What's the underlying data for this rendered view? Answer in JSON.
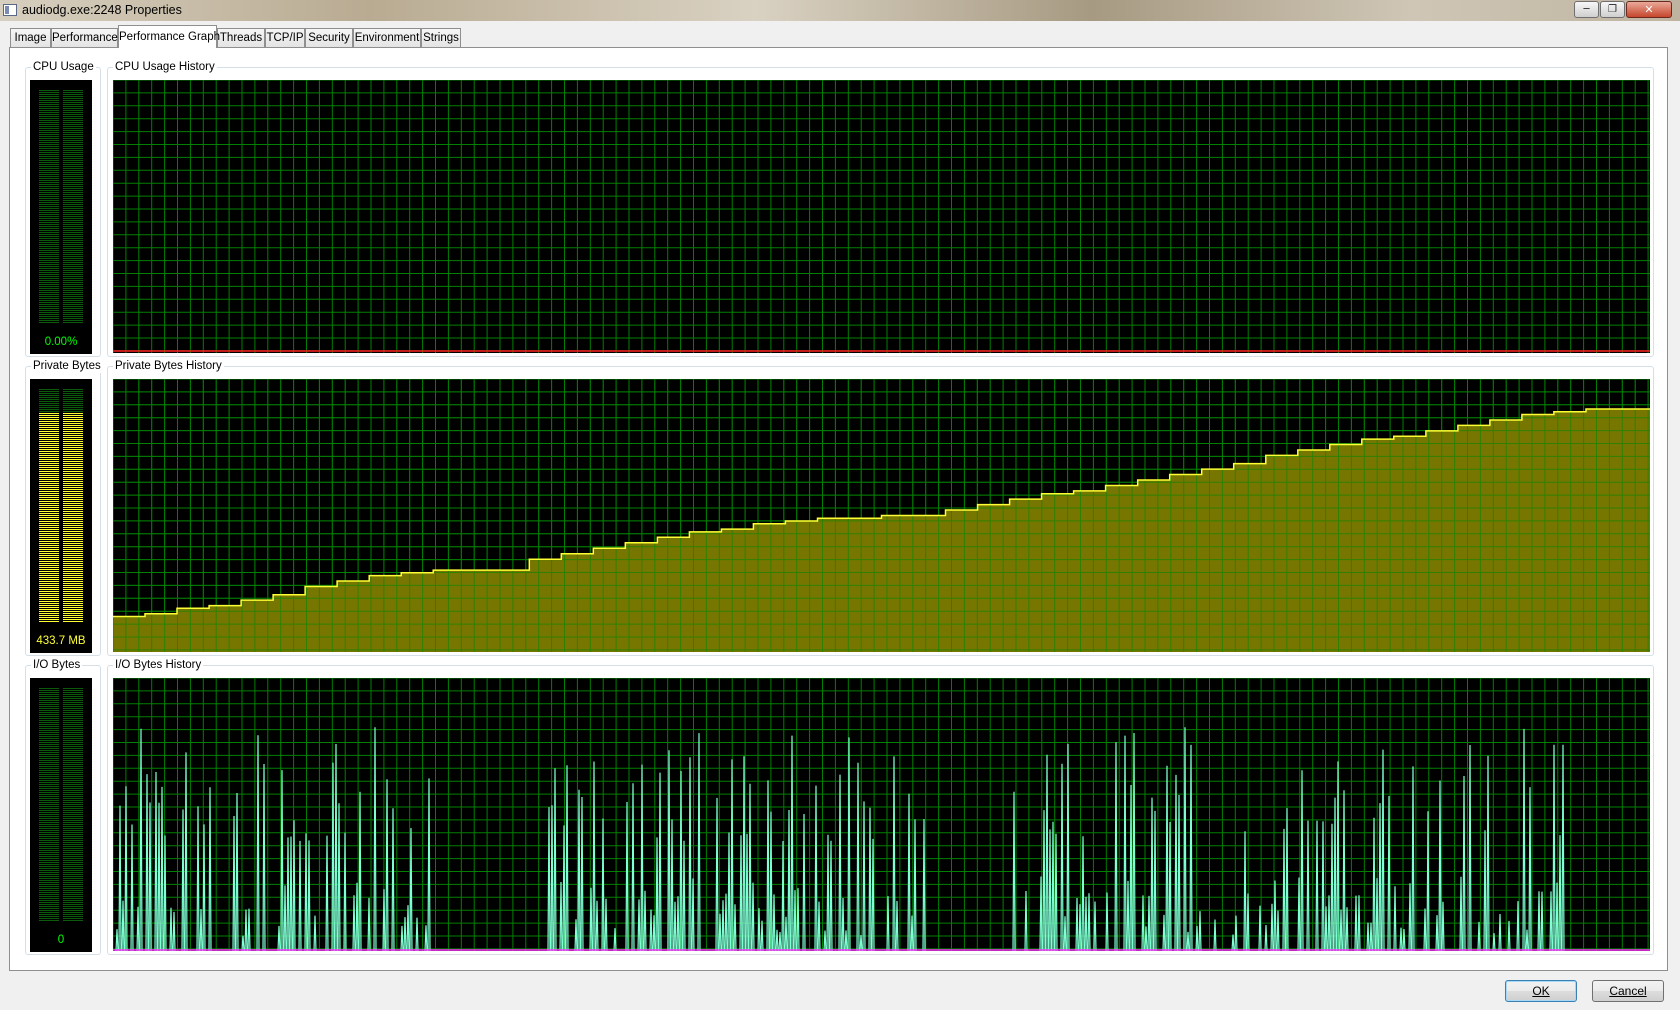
{
  "window": {
    "title": "audiodg.exe:2248 Properties",
    "controls": {
      "minimize": "─",
      "maximize": "❐",
      "close": "✕"
    }
  },
  "tabs": [
    {
      "label": "Image",
      "active": false
    },
    {
      "label": "Performance",
      "active": false
    },
    {
      "label": "Performance Graph",
      "active": true
    },
    {
      "label": "Threads",
      "active": false
    },
    {
      "label": "TCP/IP",
      "active": false
    },
    {
      "label": "Security",
      "active": false
    },
    {
      "label": "Environment",
      "active": false
    },
    {
      "label": "Strings",
      "active": false
    }
  ],
  "panels": {
    "cpu": {
      "meter_label": "CPU Usage",
      "meter_value": "0.00%",
      "meter_fraction": 0.0,
      "history_label": "CPU Usage History"
    },
    "private_bytes": {
      "meter_label": "Private Bytes",
      "meter_value": "433.7 MB",
      "meter_fraction": 0.9,
      "history_label": "Private Bytes History"
    },
    "io": {
      "meter_label": "I/O Bytes",
      "meter_value": "0",
      "meter_fraction": 0.0,
      "history_label": "I/O Bytes History"
    }
  },
  "colors": {
    "graph_background": "#000000",
    "grid": "#008000",
    "cpu_meter_text": "#00ff00",
    "cpu_line": "#ff2020",
    "private_bytes_fill": "#808000",
    "private_bytes_line": "#ffff33",
    "private_bytes_meter": "#ffff33",
    "io_line": "#7fffd4",
    "io_baseline": "#ff33ff",
    "meter_empty": "#0c5a0c"
  },
  "chart_data": [
    {
      "type": "line",
      "series": [
        {
          "values": [
            0,
            0,
            0,
            0,
            0,
            0,
            0,
            0,
            0,
            0,
            0,
            0,
            0,
            0,
            0,
            0,
            0,
            0,
            0,
            0,
            0,
            0,
            0,
            0,
            0,
            0,
            0,
            0,
            0,
            0
          ]
        }
      ],
      "ylim": [
        0,
        100
      ],
      "grid": true
    },
    {
      "type": "area",
      "series": [
        {
          "values": [
            0.13,
            0.14,
            0.16,
            0.17,
            0.19,
            0.21,
            0.24,
            0.26,
            0.28,
            0.29,
            0.3,
            0.3,
            0.3,
            0.34,
            0.36,
            0.38,
            0.4,
            0.42,
            0.44,
            0.45,
            0.47,
            0.48,
            0.49,
            0.49,
            0.5,
            0.5,
            0.52,
            0.54,
            0.56,
            0.58,
            0.59,
            0.61,
            0.63,
            0.65,
            0.67,
            0.69,
            0.72,
            0.74,
            0.76,
            0.78,
            0.79,
            0.81,
            0.83,
            0.85,
            0.87,
            0.88,
            0.89,
            0.89
          ]
        }
      ],
      "ylim": [
        0,
        1
      ],
      "grid": true
    },
    {
      "type": "line",
      "series": [
        {
          "name": "I/O Bytes",
          "values": []
        }
      ],
      "ylim": [
        0,
        1
      ],
      "grid": true
    }
  ],
  "buttons": {
    "ok": "OK",
    "cancel": "Cancel"
  }
}
